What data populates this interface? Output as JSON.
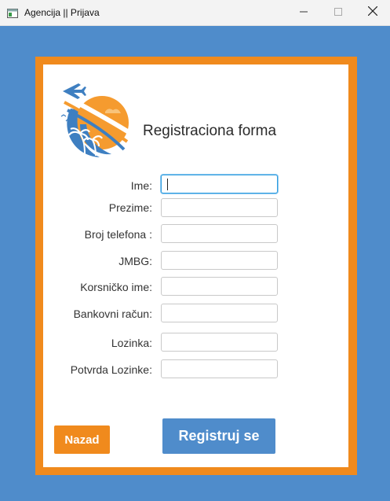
{
  "window": {
    "title": "Agencija || Prijava"
  },
  "form": {
    "title": "Registraciona forma",
    "fields": [
      {
        "label": "Ime:",
        "value": "",
        "placeholder": ""
      },
      {
        "label": "Prezime:",
        "value": "",
        "placeholder": ""
      },
      {
        "label": "Broj telefona :",
        "value": "",
        "placeholder": ""
      },
      {
        "label": "JMBG:",
        "value": "",
        "placeholder": ""
      },
      {
        "label": "Korsničko ime:",
        "value": "",
        "placeholder": ""
      },
      {
        "label": "Bankovni račun:",
        "value": "",
        "placeholder": ""
      },
      {
        "label": "Lozinka:",
        "value": "",
        "placeholder": ""
      },
      {
        "label": "Potvrda Lozinke:",
        "value": "",
        "placeholder": ""
      }
    ]
  },
  "buttons": {
    "back_label": "Nazad",
    "register_label": "Registruj se"
  },
  "colors": {
    "background": "#4f8ccb",
    "accent": "#f08a1d",
    "focus": "#2f9ee0"
  },
  "icons": [
    "app-window-icon",
    "minimize-icon",
    "maximize-icon",
    "close-icon",
    "travel-agency-logo",
    "airplane-icon",
    "palm-tree-icon"
  ]
}
